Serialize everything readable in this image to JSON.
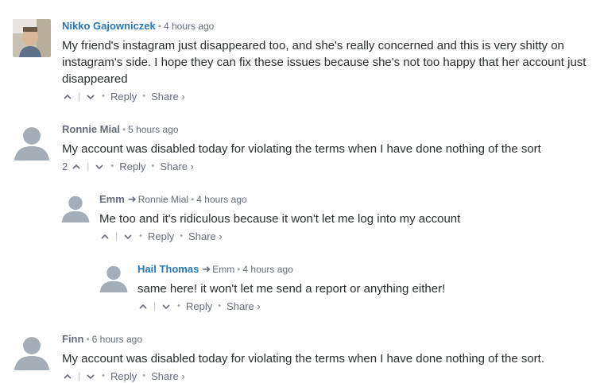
{
  "comments": [
    {
      "author": "Nikko Gajowniczek",
      "time": "4 hours ago",
      "text": "My friend's instagram just disappeared too, and she's really concerned and this is very shitty on instagram's side. I hope they can fix these issues because she's not too happy that her account just disappeared",
      "votes": "",
      "reply_label": "Reply",
      "share_label": "Share ›"
    },
    {
      "author": "Ronnie Mial",
      "time": "5 hours ago",
      "text": "My account was disabled today for violating the terms when I have done nothing of the sort",
      "votes": "2",
      "reply_label": "Reply",
      "share_label": "Share ›"
    },
    {
      "author": "Emm",
      "parent": "Ronnie Mial",
      "time": "4 hours ago",
      "text": "Me too and it's ridiculous because it won't let me log into my account",
      "votes": "",
      "reply_label": "Reply",
      "share_label": "Share ›"
    },
    {
      "author": "Hail Thomas",
      "parent": "Emm",
      "time": "4 hours ago",
      "text": "same here! it won't let me send a report or anything either!",
      "votes": "",
      "reply_label": "Reply",
      "share_label": "Share ›"
    },
    {
      "author": "Finn",
      "time": "6 hours ago",
      "text": "My account was disabled today for violating the terms when I have done nothing of the sort.",
      "votes": "",
      "reply_label": "Reply",
      "share_label": "Share ›"
    }
  ],
  "icons": {
    "upvote": "chevron-up-icon",
    "downvote": "chevron-down-icon",
    "reply_arrow": "reply-arrow-icon"
  },
  "colors": {
    "author_blue": "#2e9fff",
    "author_gray": "#656c7a",
    "text": "#2a2e2e",
    "avatar_bg": "#dbdfe4",
    "avatar_fg": "#a5adb8"
  }
}
